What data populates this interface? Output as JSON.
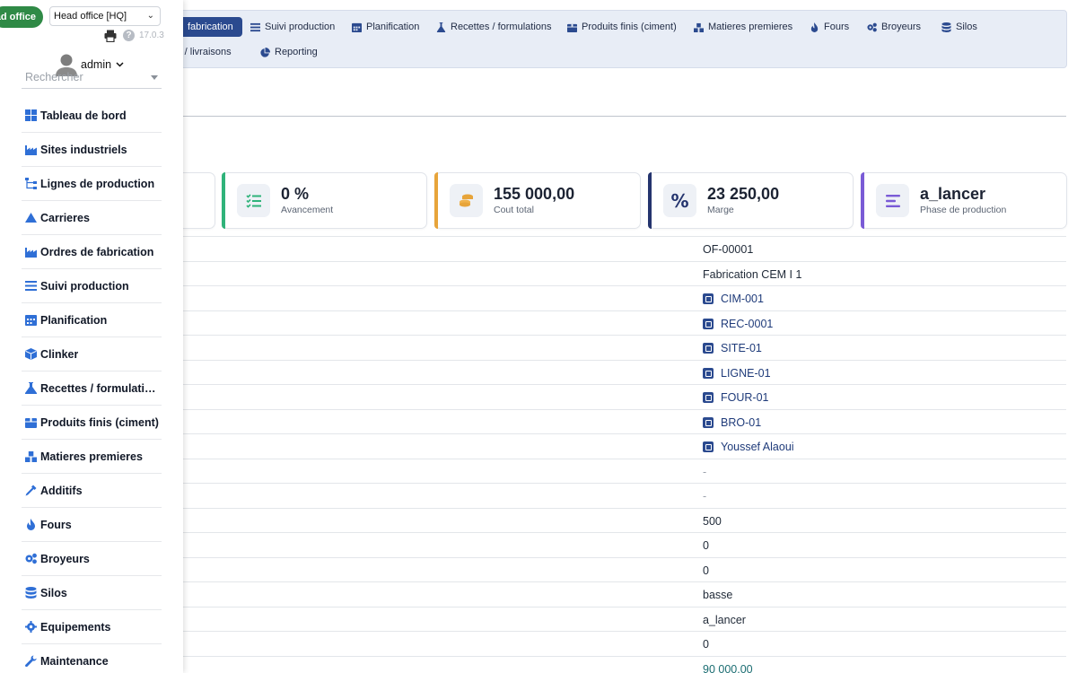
{
  "header": {
    "company_button": "ad office",
    "company_select": "Head office [HQ]",
    "version": "17.0.3",
    "user": "admin",
    "search_placeholder": "Rechercher"
  },
  "topnav": {
    "items": [
      {
        "label": "fabrication",
        "icon": "factory-icon",
        "active": true
      },
      {
        "label": "Suivi production",
        "icon": "list-icon"
      },
      {
        "label": "Planification",
        "icon": "calendar-icon"
      },
      {
        "label": "Recettes / formulations",
        "icon": "flask-icon"
      },
      {
        "label": "Produits finis (ciment)",
        "icon": "box-icon"
      },
      {
        "label": "Matieres premieres",
        "icon": "cubes-icon"
      },
      {
        "label": "Fours",
        "icon": "fire-icon"
      },
      {
        "label": "Broyeurs",
        "icon": "gears-icon"
      },
      {
        "label": "Silos",
        "icon": "database-icon"
      },
      {
        "label": "ns / livraisons",
        "icon": ""
      },
      {
        "label": "Reporting",
        "icon": "chart-pie-icon"
      }
    ]
  },
  "kpis": [
    {
      "value": "0 %",
      "label": "Avancement",
      "icon": "checklist-icon",
      "color": "#2fb37a"
    },
    {
      "value": "155 000,00",
      "label": "Cout total",
      "icon": "coins-icon",
      "color": "#e7a43a"
    },
    {
      "value": "23 250,00",
      "label": "Marge",
      "icon": "percent-icon",
      "color": "#24346e"
    },
    {
      "value": "a_lancer",
      "label": "Phase de production",
      "icon": "stack-icon",
      "color": "#7a5bd6"
    }
  ],
  "details": [
    {
      "value": "OF-00001",
      "type": "text"
    },
    {
      "value": "Fabrication CEM I 1",
      "type": "text"
    },
    {
      "value": "CIM-001",
      "type": "link"
    },
    {
      "value": "REC-0001",
      "type": "link"
    },
    {
      "value": "SITE-01",
      "type": "link"
    },
    {
      "value": "LIGNE-01",
      "type": "link"
    },
    {
      "value": "FOUR-01",
      "type": "link"
    },
    {
      "value": "BRO-01",
      "type": "link"
    },
    {
      "value": "Youssef Alaoui",
      "type": "link"
    },
    {
      "value": "-",
      "type": "dash"
    },
    {
      "value": "-",
      "type": "dash"
    },
    {
      "value": "500",
      "type": "text"
    },
    {
      "value": "0",
      "type": "text"
    },
    {
      "value": "0",
      "type": "text"
    },
    {
      "value": "basse",
      "type": "text"
    },
    {
      "value": "a_lancer",
      "type": "text"
    },
    {
      "value": "0",
      "type": "text"
    },
    {
      "value": "90 000,00",
      "type": "money"
    }
  ],
  "sidebar": {
    "items": [
      {
        "label": "Tableau de bord",
        "icon": "dashboard-icon"
      },
      {
        "label": "Sites industriels",
        "icon": "industry-icon"
      },
      {
        "label": "Lignes de production",
        "icon": "sitemap-icon"
      },
      {
        "label": "Carrieres",
        "icon": "mountain-icon"
      },
      {
        "label": "Ordres de fabrication",
        "icon": "industry-icon"
      },
      {
        "label": "Suivi production",
        "icon": "list-icon"
      },
      {
        "label": "Planification",
        "icon": "calendar-icon"
      },
      {
        "label": "Clinker",
        "icon": "cube-icon"
      },
      {
        "label": "Recettes / formulatio…",
        "icon": "flask-icon"
      },
      {
        "label": "Produits finis (ciment)",
        "icon": "box-icon"
      },
      {
        "label": "Matieres premieres",
        "icon": "cubes-icon"
      },
      {
        "label": "Additifs",
        "icon": "eyedropper-icon"
      },
      {
        "label": "Fours",
        "icon": "fire-icon"
      },
      {
        "label": "Broyeurs",
        "icon": "gears-icon"
      },
      {
        "label": "Silos",
        "icon": "database-icon"
      },
      {
        "label": "Equipements",
        "icon": "gear-icon"
      },
      {
        "label": "Maintenance",
        "icon": "wrench-icon"
      }
    ]
  }
}
